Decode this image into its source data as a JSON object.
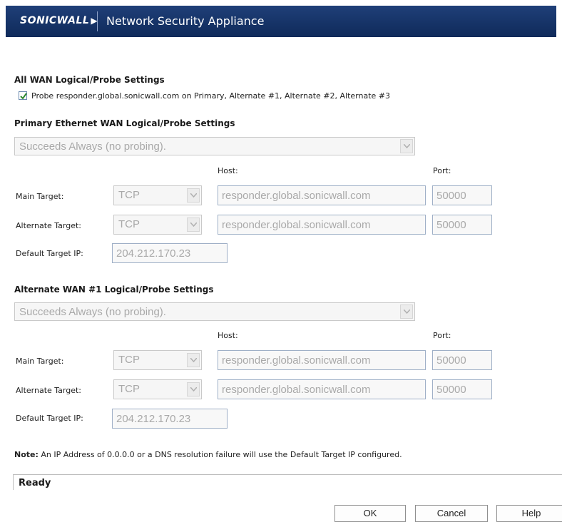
{
  "header": {
    "logo": "SONICWALL",
    "title": "Network Security Appliance"
  },
  "all_wan": {
    "title": "All WAN Logical/Probe Settings",
    "probe_checked": true,
    "probe_label": "Probe responder.global.sonicwall.com on Primary, Alternate #1, Alternate #2, Alternate #3"
  },
  "primary": {
    "title": "Primary Ethernet WAN Logical/Probe Settings",
    "probe_mode": "Succeeds Always (no probing).",
    "host_header": "Host:",
    "port_header": "Port:",
    "main_label": "Main Target:",
    "main_protocol": "TCP",
    "main_host": "responder.global.sonicwall.com",
    "main_port": "50000",
    "alt_label": "Alternate Target:",
    "alt_protocol": "TCP",
    "alt_host": "responder.global.sonicwall.com",
    "alt_port": "50000",
    "default_ip_label": "Default Target IP:",
    "default_ip": "204.212.170.23"
  },
  "alternate1": {
    "title": "Alternate WAN #1 Logical/Probe Settings",
    "probe_mode": "Succeeds Always (no probing).",
    "host_header": "Host:",
    "port_header": "Port:",
    "main_label": "Main Target:",
    "main_protocol": "TCP",
    "main_host": "responder.global.sonicwall.com",
    "main_port": "50000",
    "alt_label": "Alternate Target:",
    "alt_protocol": "TCP",
    "alt_host": "responder.global.sonicwall.com",
    "alt_port": "50000",
    "default_ip_label": "Default Target IP:",
    "default_ip": "204.212.170.23"
  },
  "note": {
    "prefix": "Note:",
    "text": " An IP Address of 0.0.0.0 or a DNS resolution failure will use the Default Target IP configured."
  },
  "status": {
    "text": "Ready"
  },
  "buttons": {
    "ok": "OK",
    "cancel": "Cancel",
    "help": "Help"
  },
  "icons": {
    "check": "check-icon",
    "dropdown": "chevron-down-icon"
  },
  "colors": {
    "header_bg": "#1f3f78",
    "check": "#2e8b2e",
    "disabled_text": "#a9a9a9"
  }
}
